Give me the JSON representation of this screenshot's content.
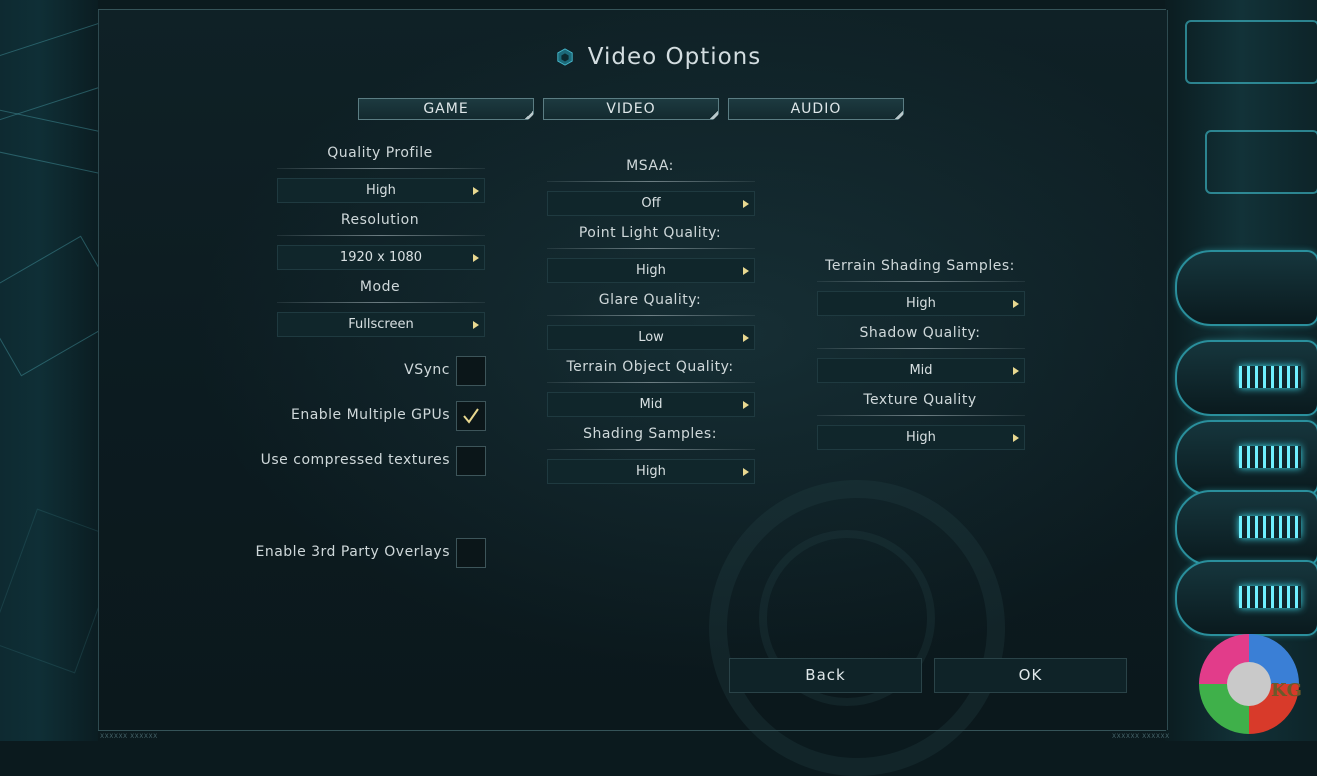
{
  "title": "Video Options",
  "tabs": [
    "GAME",
    "VIDEO",
    "AUDIO"
  ],
  "left": {
    "quality_profile": {
      "label": "Quality Profile",
      "value": "High"
    },
    "resolution": {
      "label": "Resolution",
      "value": "1920 x 1080"
    },
    "mode": {
      "label": "Mode",
      "value": "Fullscreen"
    },
    "checkboxes": [
      {
        "label": "VSync",
        "checked": false
      },
      {
        "label": "Enable Multiple GPUs",
        "checked": true
      },
      {
        "label": "Use compressed textures",
        "checked": false
      },
      {
        "label": "Enable 3rd Party Overlays",
        "checked": false
      }
    ]
  },
  "middle": [
    {
      "label": "MSAA:",
      "value": "Off"
    },
    {
      "label": "Point Light Quality:",
      "value": "High"
    },
    {
      "label": "Glare Quality:",
      "value": "Low"
    },
    {
      "label": "Terrain Object Quality:",
      "value": "Mid"
    },
    {
      "label": "Shading Samples:",
      "value": "High"
    }
  ],
  "right": [
    {
      "label": "Terrain Shading Samples:",
      "value": "High"
    },
    {
      "label": "Shadow Quality:",
      "value": "Mid"
    },
    {
      "label": "Texture Quality",
      "value": "High"
    }
  ],
  "buttons": {
    "back": "Back",
    "ok": "OK"
  },
  "footer": {
    "left": "XXXXXX XXXXXX",
    "right": "XXXXXX XXXXXX"
  },
  "colors": {
    "accent": "#e8d890",
    "panel": "#0c1b20",
    "neon": "#3fe0f0"
  },
  "icons": {
    "title": "hexagon-cube-icon",
    "dropdown": "triangle-right-icon",
    "check": "checkmark-icon"
  },
  "watermark": "KG"
}
